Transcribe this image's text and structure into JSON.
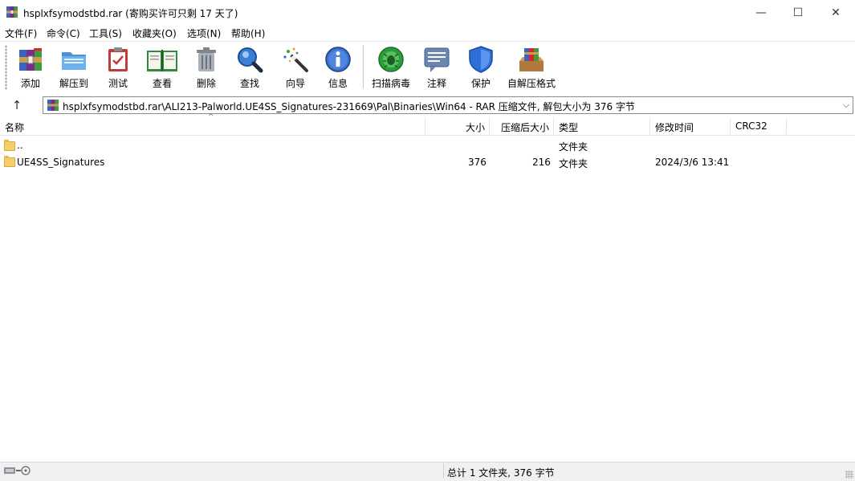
{
  "window": {
    "title": "hsplxfsymodstbd.rar (寄购买许可只剩 17 天了)",
    "minimize": "—",
    "maximize": "☐",
    "close": "✕"
  },
  "menu": [
    "文件(F)",
    "命令(C)",
    "工具(S)",
    "收藏夹(O)",
    "选项(N)",
    "帮助(H)"
  ],
  "toolbar": {
    "add": "添加",
    "extract": "解压到",
    "test": "测试",
    "view": "查看",
    "delete": "删除",
    "find": "查找",
    "wizard": "向导",
    "info": "信息",
    "scan": "扫描病毒",
    "comment": "注释",
    "protect": "保护",
    "sfx": "自解压格式"
  },
  "address": {
    "up_glyph": "↑",
    "path": "hsplxfsymodstbd.rar\\ALI213-Palworld.UE4SS_Signatures-231669\\Pal\\Binaries\\Win64 - RAR 压缩文件, 解包大小为 376 字节",
    "dropdown_glyph": "⌵"
  },
  "columns": {
    "name": "名称",
    "size": "大小",
    "packed": "压缩后大小",
    "type": "类型",
    "modified": "修改时间",
    "crc": "CRC32"
  },
  "rows": [
    {
      "name": "..",
      "size": "",
      "packed": "",
      "type": "文件夹",
      "modified": "",
      "crc": ""
    },
    {
      "name": "UE4SS_Signatures",
      "size": "376",
      "packed": "216",
      "type": "文件夹",
      "modified": "2024/3/6 13:41",
      "crc": ""
    }
  ],
  "status": {
    "summary": "总计 1 文件夹, 376 字节"
  },
  "colors": {
    "folder": "#f4cf6c",
    "status_bg": "#f0f0f0"
  }
}
